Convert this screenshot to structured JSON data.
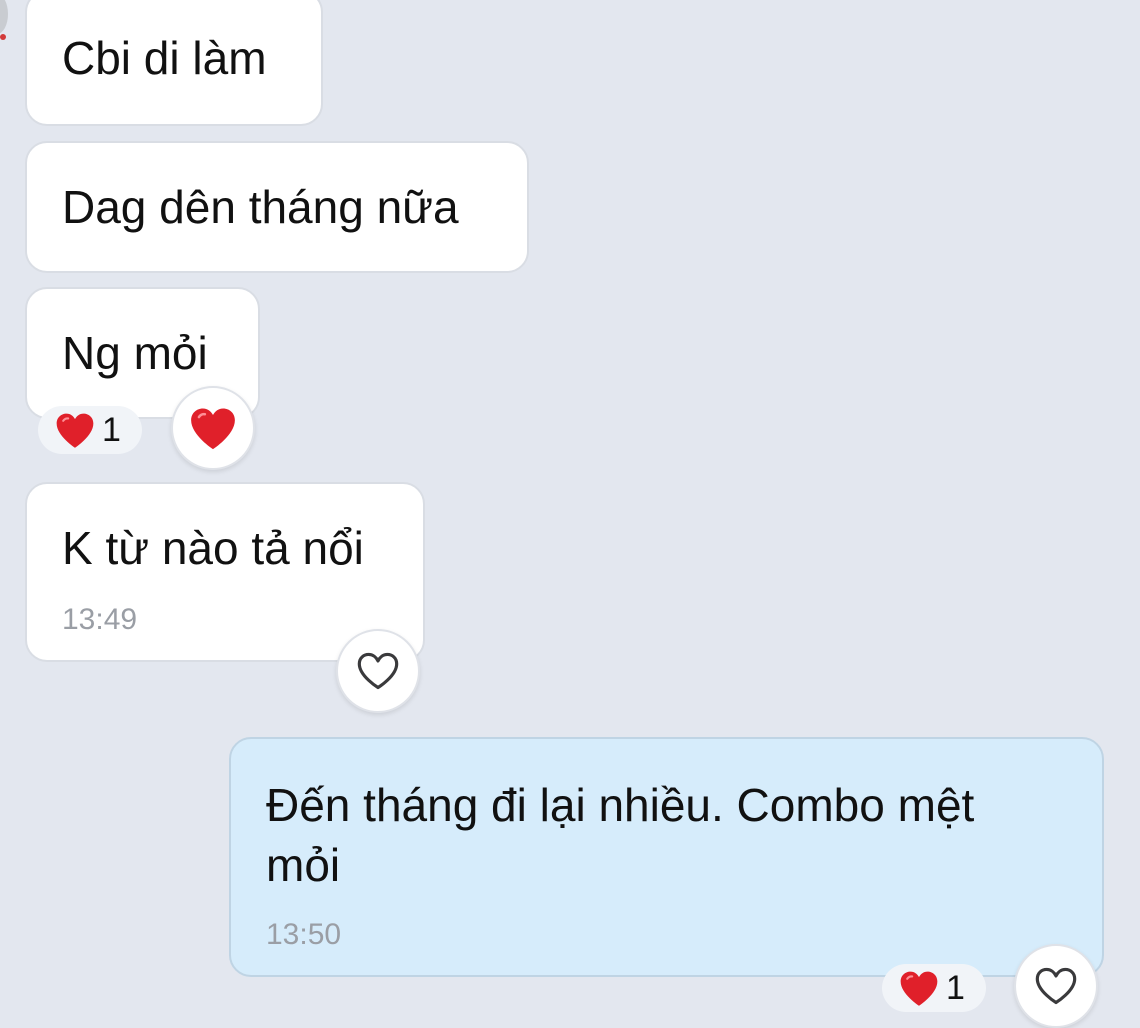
{
  "messages": [
    {
      "text": "Cbi di làm"
    },
    {
      "text": "Dag dên tháng nữa"
    },
    {
      "text": "Ng mỏi",
      "reaction": {
        "emoji": "heart",
        "count": "1"
      }
    },
    {
      "text": "K từ nào tả nổi",
      "time": "13:49"
    },
    {
      "text_line1": "Đến tháng đi lại nhiều. Combo mệt",
      "text_line2": "mỏi",
      "time": "13:50",
      "reaction": {
        "emoji": "heart",
        "count": "1"
      }
    }
  ],
  "colors": {
    "background": "#e3e7ef",
    "incoming_bubble": "#ffffff",
    "outgoing_bubble": "#d6ecfb",
    "heart": "#e0202a",
    "timestamp": "#9a9ea5"
  },
  "icons": {
    "reaction_heart": "heart-emoji-icon",
    "react_empty": "heart-outline-icon"
  }
}
